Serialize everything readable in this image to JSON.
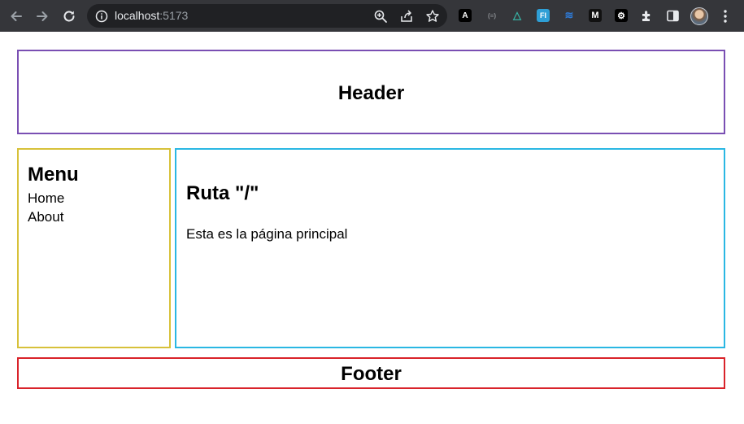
{
  "browser": {
    "url_host": "localhost",
    "url_port": ":5173",
    "icons": {
      "back": "back-arrow-icon",
      "forward": "forward-arrow-icon",
      "reload": "reload-icon",
      "site_info": "info-icon",
      "zoom": "zoom-icon",
      "share": "share-icon",
      "bookmark": "star-icon",
      "extensions": "puzzle-icon",
      "side_panel": "side-panel-icon",
      "menu": "kebab-menu-icon"
    },
    "extensions": [
      {
        "glyph": "A",
        "bg": "#000000",
        "fg": "#ffffff"
      },
      {
        "glyph": "(≡)",
        "bg": "#35363a",
        "fg": "#8a8d91"
      },
      {
        "glyph": "△",
        "bg": "#35363a",
        "fg": "#37b3a4"
      },
      {
        "glyph": "FI",
        "bg": "#2e9fd6",
        "fg": "#ffffff"
      },
      {
        "glyph": "≋",
        "bg": "#35363a",
        "fg": "#2e7ad6"
      },
      {
        "glyph": "M",
        "bg": "#111111",
        "fg": "#ffffff"
      },
      {
        "glyph": "⚙",
        "bg": "#000000",
        "fg": "#ffffff"
      }
    ]
  },
  "page": {
    "header_title": "Header",
    "menu": {
      "title": "Menu",
      "links": [
        "Home",
        "About"
      ]
    },
    "main": {
      "route_title": "Ruta \"/\"",
      "description": "Esta es la página principal"
    },
    "footer_title": "Footer"
  },
  "colors": {
    "header_border": "#7a4fb3",
    "menu_border": "#d7c13a",
    "main_border": "#2ab7e3",
    "footer_border": "#d9232a"
  }
}
